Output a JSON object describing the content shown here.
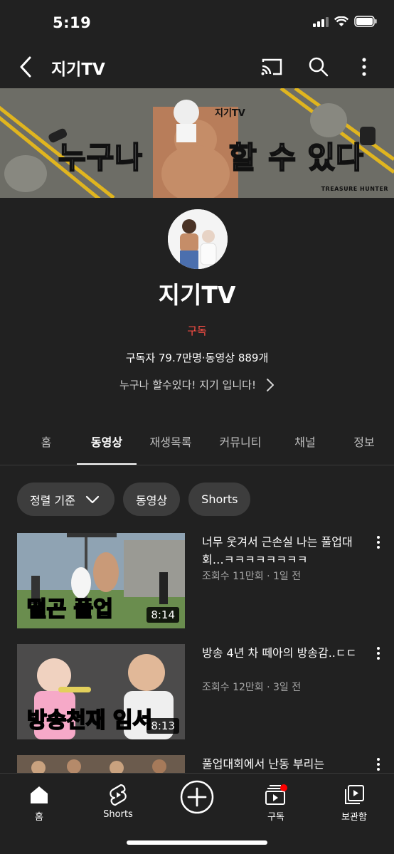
{
  "status": {
    "time": "5:19"
  },
  "header": {
    "title": "지기TV"
  },
  "banner": {
    "left_text": "누구나",
    "right_text": "할 수 있다",
    "logo_text": "지기TV",
    "credit": "TREASURE HUNTER"
  },
  "channel": {
    "name": "지기TV",
    "subscribe_label": "구독",
    "stats": "구독자 79.7만명·동영상 889개",
    "description": "누구나 할수있다! 지기 입니다!"
  },
  "tabs": [
    {
      "label": "홈"
    },
    {
      "label": "동영상"
    },
    {
      "label": "재생목록"
    },
    {
      "label": "커뮤니티"
    },
    {
      "label": "채널"
    },
    {
      "label": "정보"
    }
  ],
  "chips": {
    "sort_label": "정렬 기준",
    "videos_label": "동영상",
    "shorts_label": "Shorts"
  },
  "videos": [
    {
      "title": "너무 웃겨서 근손실 나는 풀업대회…ㅋㅋㅋㅋㅋㅋㅋㅋ",
      "meta": "조회수 11만회 · 1일 전",
      "duration": "8:14",
      "caption": "떨곤 풀업"
    },
    {
      "title": "방송 4년 차 떼아의 방송감..ㄷㄷ",
      "meta": "조회수 12만회 · 3일 전",
      "duration": "8:13",
      "caption": "방송천재 임서"
    },
    {
      "title": "풀업대회에서 난동 부리는",
      "meta": "",
      "duration": "",
      "caption": ""
    }
  ],
  "bottom_nav": [
    {
      "label": "홈",
      "icon": "home-icon"
    },
    {
      "label": "Shorts",
      "icon": "shorts-icon"
    },
    {
      "label": "",
      "icon": "create-icon"
    },
    {
      "label": "구독",
      "icon": "subscriptions-icon"
    },
    {
      "label": "보관함",
      "icon": "library-icon"
    }
  ],
  "colors": {
    "background": "#212121",
    "accent": "#ff4e45",
    "chip": "#3d3d3d",
    "meta": "#a8a8a8"
  }
}
